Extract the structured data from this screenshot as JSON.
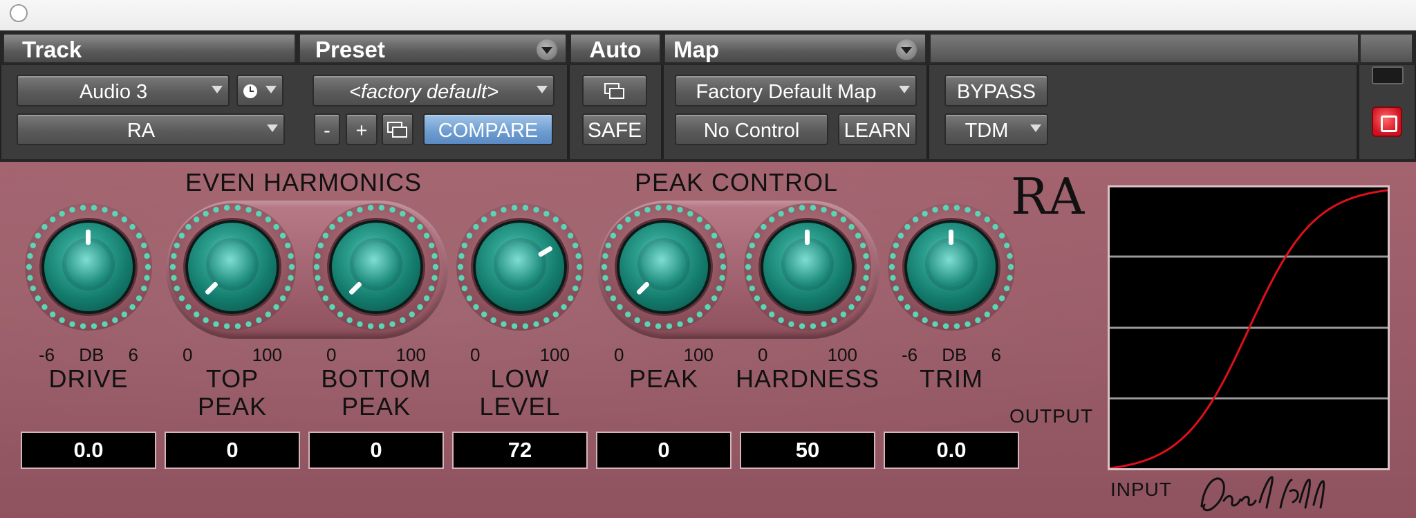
{
  "header": {
    "track_title": "Track",
    "preset_title": "Preset",
    "auto_title": "Auto",
    "map_title": "Map",
    "track_name": "Audio 3",
    "plugin_name": "RA",
    "preset_name": "<factory default>",
    "preset_minus": "-",
    "preset_plus": "+",
    "compare_label": "COMPARE",
    "safe_label": "SAFE",
    "map_name": "Factory Default Map",
    "no_control_label": "No Control",
    "learn_label": "LEARN",
    "bypass_label": "BYPASS",
    "format_label": "TDM"
  },
  "plugin": {
    "brand": "RA",
    "even_harmonics_label": "EVEN HARMONICS",
    "peak_control_label": "PEAK CONTROL",
    "output_label": "OUTPUT",
    "input_label": "INPUT",
    "knobs": [
      {
        "name_line1": "DRIVE",
        "name_line2": "",
        "scale_min": "-6",
        "scale_mid": "DB",
        "scale_max": "6",
        "value": "0.0",
        "position": 0.5
      },
      {
        "name_line1": "TOP",
        "name_line2": "PEAK",
        "scale_min": "0",
        "scale_mid": "",
        "scale_max": "100",
        "value": "0",
        "position": 0.0
      },
      {
        "name_line1": "BOTTOM",
        "name_line2": "PEAK",
        "scale_min": "0",
        "scale_mid": "",
        "scale_max": "100",
        "value": "0",
        "position": 0.0
      },
      {
        "name_line1": "LOW",
        "name_line2": "LEVEL",
        "scale_min": "0",
        "scale_mid": "",
        "scale_max": "100",
        "value": "72",
        "position": 0.72
      },
      {
        "name_line1": "PEAK",
        "name_line2": "",
        "scale_min": "0",
        "scale_mid": "",
        "scale_max": "100",
        "value": "0",
        "position": 0.0
      },
      {
        "name_line1": "HARDNESS",
        "name_line2": "",
        "scale_min": "0",
        "scale_mid": "",
        "scale_max": "100",
        "value": "50",
        "position": 0.5
      },
      {
        "name_line1": "TRIM",
        "name_line2": "",
        "scale_min": "-6",
        "scale_mid": "DB",
        "scale_max": "6",
        "value": "0.0",
        "position": 0.5
      }
    ]
  },
  "colors": {
    "plugin_body": "#9a5b68",
    "knob": "#1f8c7c",
    "ring_dots": "#58d6b6",
    "curve": "#e0101a",
    "compare_button": "#7aa6d6",
    "power_button": "#e0202c"
  },
  "icons": [
    "window-close-circle-icon",
    "clock-icon",
    "duplicate-window-icon",
    "dropdown-arrow-icon",
    "power-icon"
  ]
}
